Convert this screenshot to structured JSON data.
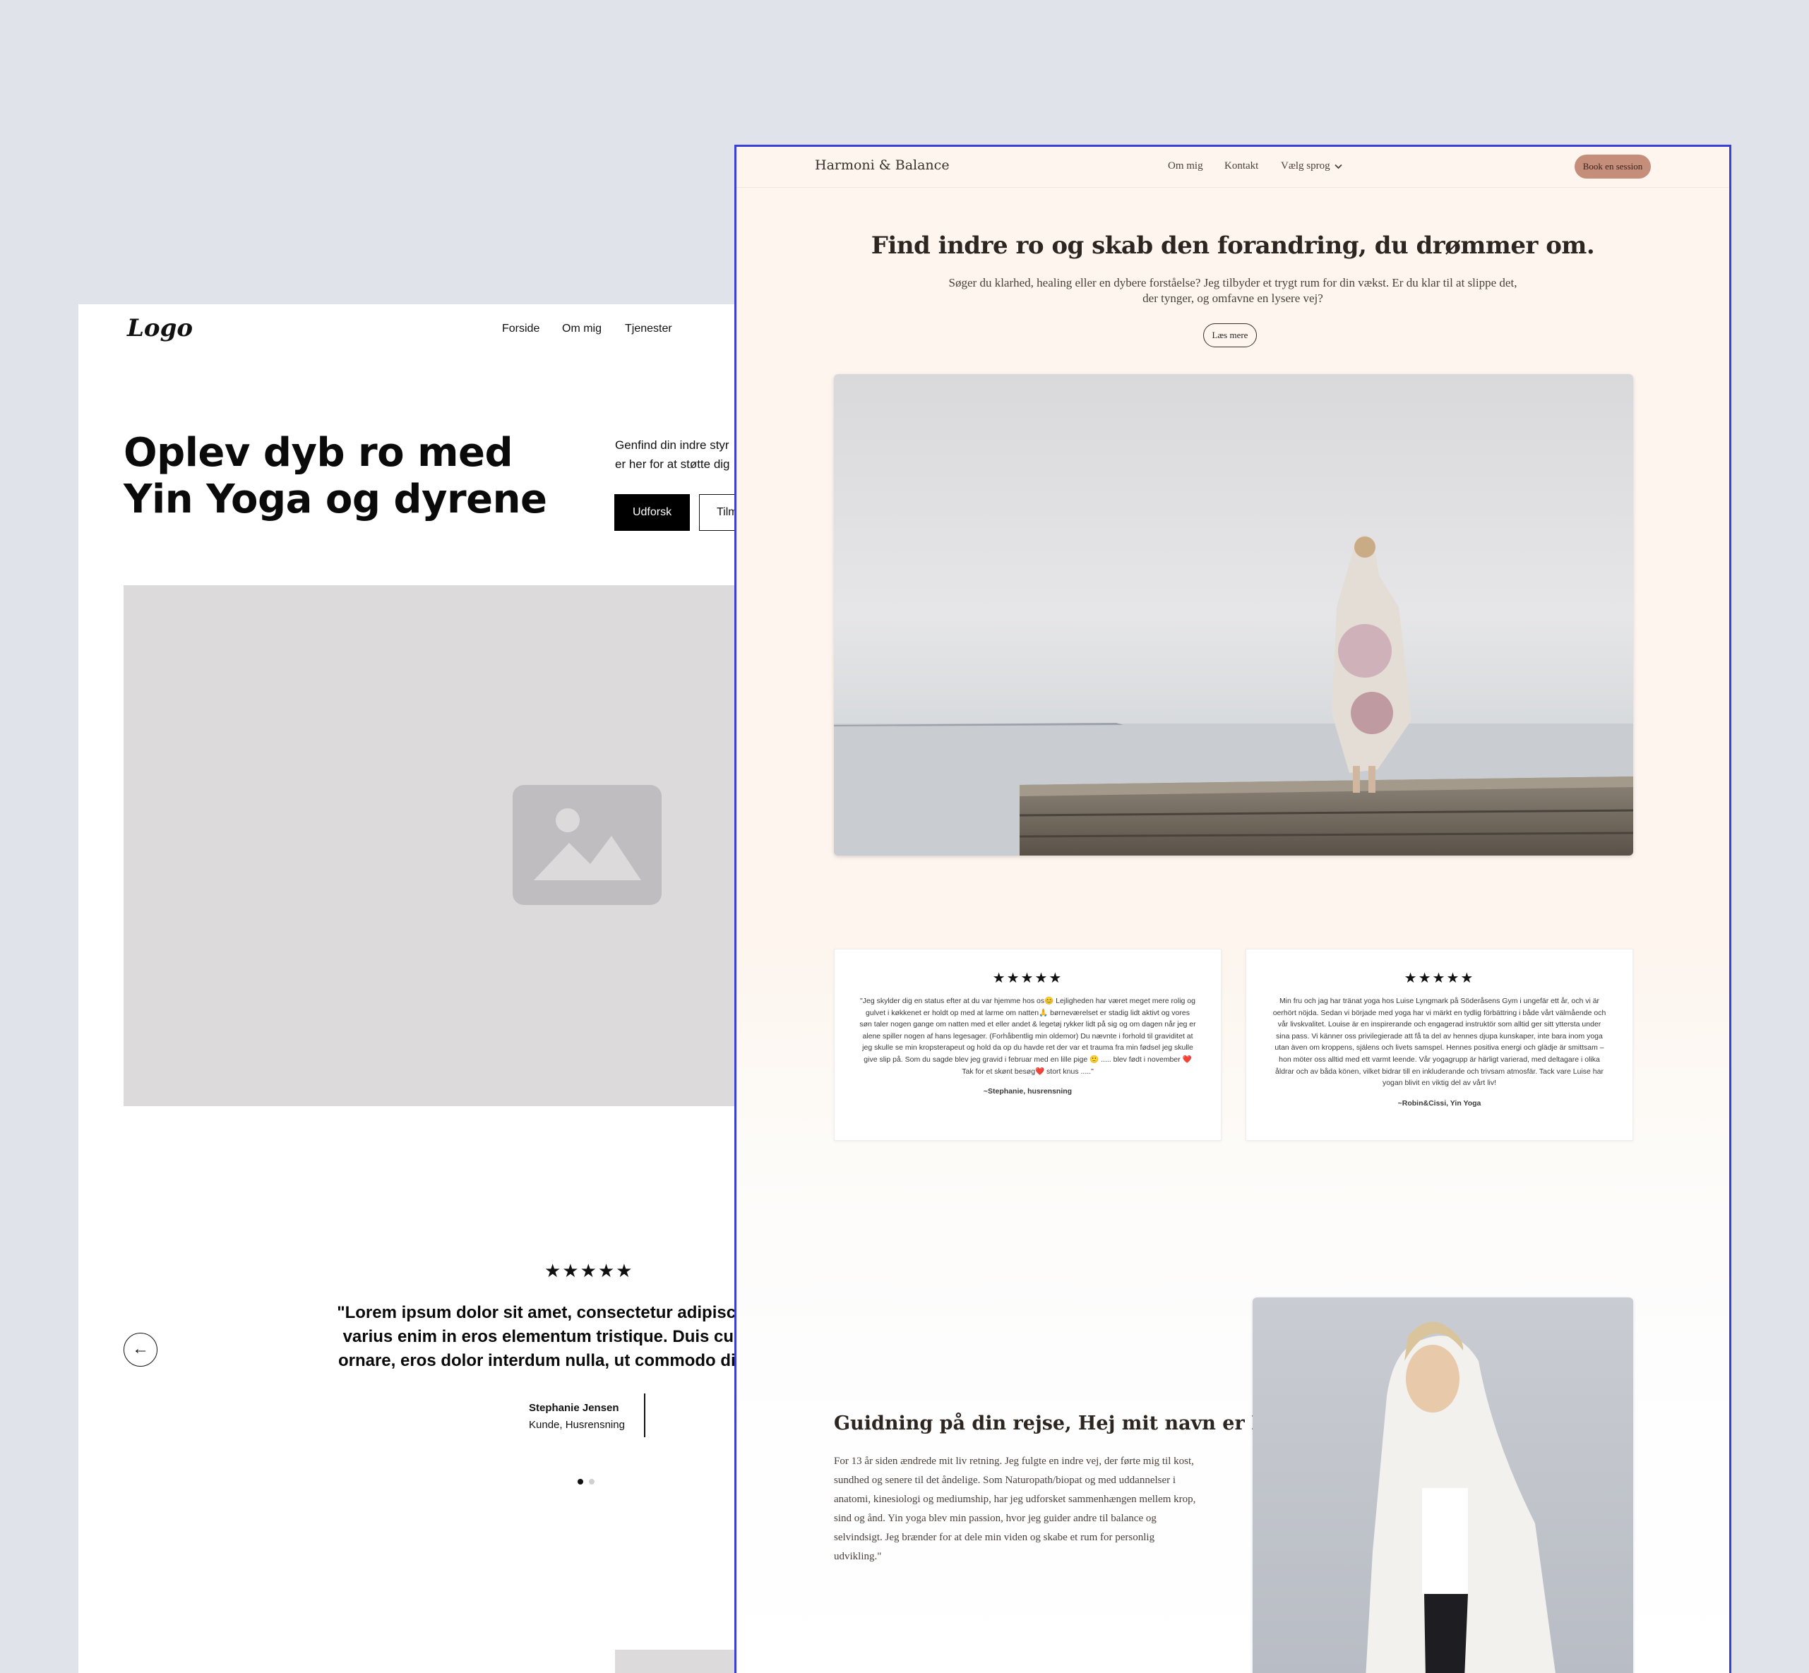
{
  "wireframe": {
    "logo": "Logo",
    "nav": [
      "Forside",
      "Om mig",
      "Tjenester"
    ],
    "hero_title": "Oplev dyb ro med Yin Yoga og dyrene",
    "hero_text": "Genfind din indre styr\ner her for at støtte dig",
    "explore_button": "Udforsk",
    "secondary_button": "Tilm",
    "stars": "★★★★★",
    "quote": "\"Lorem ipsum dolor sit amet, consectetur adipiscing el\nvarius enim in eros elementum tristique. Duis cursus,\nornare, eros dolor interdum nulla, ut commodo diam lil",
    "prev_arrow": "←",
    "author_name": "Stephanie Jensen",
    "author_role": "Kunde, Husrensning",
    "carousel": {
      "slides": 2,
      "active": 1
    }
  },
  "site": {
    "brand": "Harmoni & Balance",
    "nav": {
      "about": "Om mig",
      "contact": "Kontakt",
      "language": "Vælg sprog"
    },
    "book_button": "Book en session",
    "hero_title": "Find indre ro og skab den forandring, du drømmer om.",
    "hero_subtitle": "Søger du klarhed, healing eller en dybere forståelse? Jeg tilbyder et trygt rum for din vækst. Er du klar til at slippe det,\nder tynger, og omfavne en lysere vej?",
    "more_button": "Læs mere",
    "testimonials": [
      {
        "stars": "★★★★★",
        "text": "\"Jeg skylder dig en status efter at du var hjemme hos os😊 Lejligheden har været meget mere rolig og gulvet i køkkenet er holdt op med at larme om natten🙏 børneværelset er stadig lidt aktivt og vores søn taler nogen gange om natten med et eller andet & legetøj rykker lidt på sig og om dagen når jeg er alene spiller nogen af hans legesager. (Forhåbentlig min oldemor) Du nævnte i forhold til graviditet at jeg skulle se min kropsterapeut og hold da op du havde ret der var et trauma fra min fødsel jeg skulle give slip på. Som du sagde blev jeg gravid i februar med en lille pige 🙂 ..... blev født i november ❤️ Tak for et skønt besøg❤️ stort knus .....\"",
        "author": "~Stephanie, husrensning"
      },
      {
        "stars": "★★★★★",
        "text": "Min fru och jag har tränat yoga hos Luise Lyngmark på Söderåsens Gym i ungefär ett år, och vi är oerhört nöjda. Sedan vi började med yoga har vi märkt en tydlig förbättring i både vårt välmående och vår livskvalitet. Louise är en inspirerande och engagerad instruktör som alltid ger sitt yttersta under sina pass. Vi känner oss privilegierade att få ta del av hennes djupa kunskaper, inte bara inom yoga utan även om kroppens, själens och livets samspel. Hennes positiva energi och glädje är smittsam – hon möter oss alltid med ett varmt leende. Vår yogagrupp är härligt varierad, med deltagare i olika åldrar och av båda könen, vilket bidrar till en inkluderande och trivsam atmosfär. Tack vare Luise har yogan blivit en viktig del av vårt liv!",
        "author": "~Robin&Cissi, Yin Yoga"
      }
    ],
    "about_title": "Guidning på din rejse, Hej mit navn er Luise!",
    "about_text": "For 13 år siden ændrede mit liv retning. Jeg fulgte en indre vej, der førte mig til kost, sundhed og senere til det åndelige. Som Naturopath/biopat og med uddannelser i anatomi, kinesiologi og mediumship, har jeg udforsket sammenhængen mellem krop, sind og ånd. Yin yoga blev min passion, hvor jeg guider andre til balance og selvindsigt. Jeg brænder for at dele min viden og skabe et rum for personlig udvikling.\""
  },
  "colors": {
    "background": "#e1e3eb",
    "frame_border": "#3b3fd9",
    "site_bg": "#fdf5ee",
    "accent": "#c58e7b"
  },
  "icons": [
    "image-placeholder-icon",
    "arrow-left-icon",
    "chevron-down-icon",
    "star-icon"
  ]
}
